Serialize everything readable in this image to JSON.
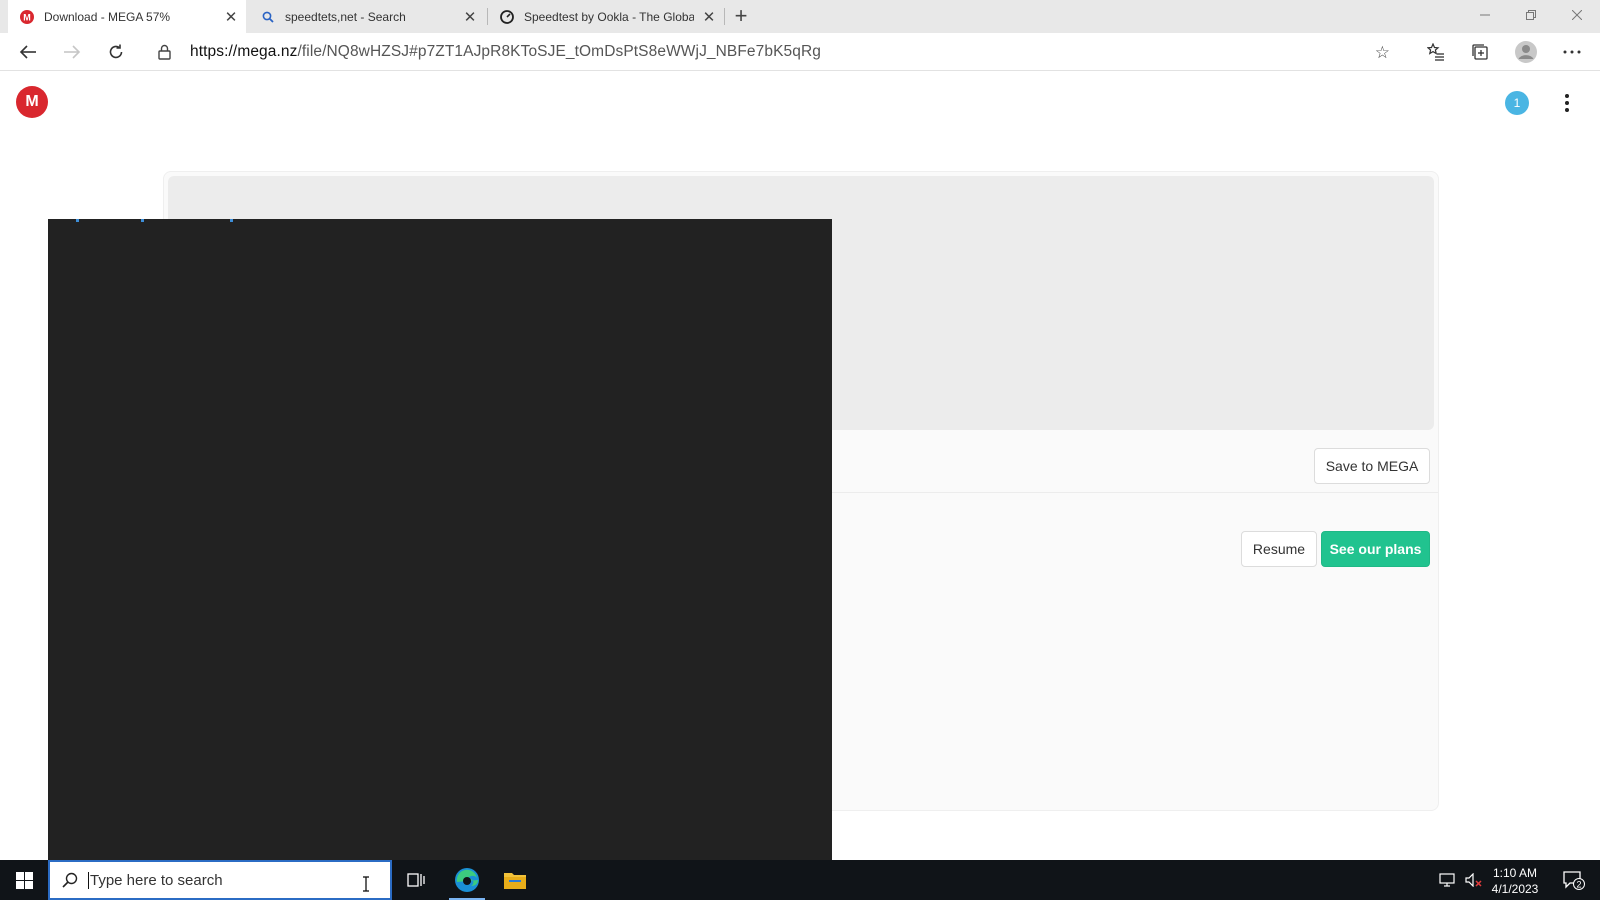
{
  "browser": {
    "tabs": [
      {
        "title": "Download - MEGA 57%",
        "icon": "mega-icon",
        "active": true
      },
      {
        "title": "speedtets,net - Search",
        "icon": "search-icon",
        "active": false
      },
      {
        "title": "Speedtest by Ookla - The Global",
        "icon": "speedtest-icon",
        "active": false
      }
    ],
    "url_host": "https://mega.nz",
    "url_path": "/file/NQ8wHZSJ#p7ZT1AJpR8KToSJE_tOmDsPtS8eWWjJ_NBFe7bK5qRg"
  },
  "mega": {
    "logo_letter": "M",
    "notification_count": "1",
    "save_label": "Save to MEGA",
    "resume_label": "Resume",
    "plans_label": "See our plans",
    "accent": "#21c38f",
    "brand": "#d9272e"
  },
  "taskbar": {
    "search_placeholder": "Type here to search",
    "time": "1:10 AM",
    "date": "4/1/2023",
    "notification_count": "2"
  }
}
